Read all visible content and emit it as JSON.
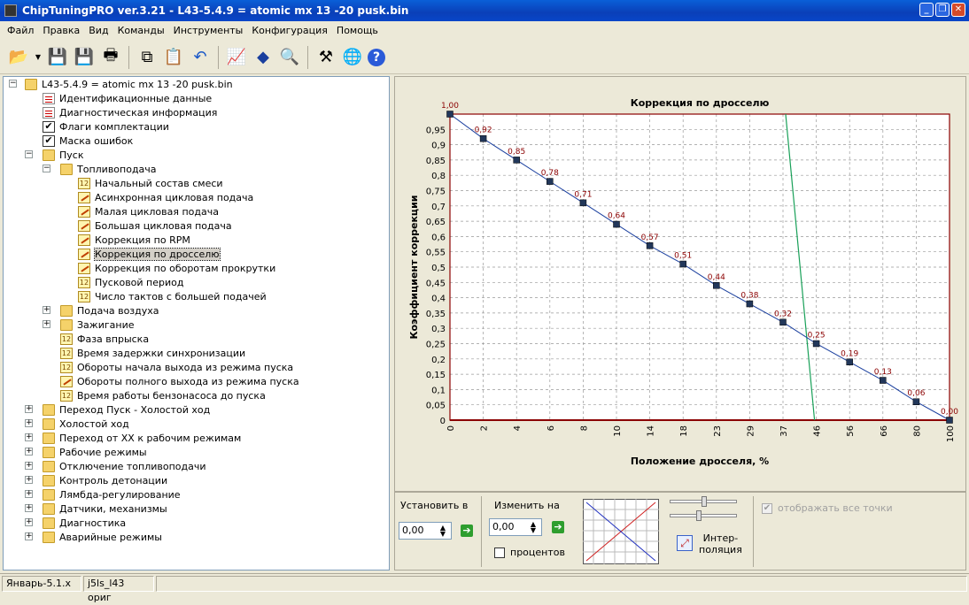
{
  "window": {
    "title": "ChipTuningPRO ver.3.21 - L43-5.4.9 = atomic mx 13 -20 pusk.bin"
  },
  "menu": [
    "Файл",
    "Правка",
    "Вид",
    "Команды",
    "Инструменты",
    "Конфигурация",
    "Помощь"
  ],
  "toolbar": {
    "icons": [
      "open-icon",
      "dropdown-arrow-icon",
      "save-icon",
      "save-as-icon",
      "print-icon",
      "copy-icon",
      "paste-icon",
      "undo-icon",
      "chart-icon",
      "info-icon",
      "zoom-icon",
      "tools-icon",
      "network-icon",
      "help-icon"
    ]
  },
  "tree": {
    "root": "L43-5.4.9 = atomic mx 13 -20 pusk.bin",
    "items": [
      {
        "label": "Идентификационные данные",
        "icon": "doc"
      },
      {
        "label": "Диагностическая информация",
        "icon": "doc"
      },
      {
        "label": "Флаги комплектации",
        "icon": "chk"
      },
      {
        "label": "Маска ошибок",
        "icon": "chk"
      },
      {
        "label": "Пуск",
        "icon": "folder"
      },
      {
        "label": "Топливоподача",
        "icon": "folder"
      },
      {
        "label": "Начальный состав смеси",
        "icon": "num"
      },
      {
        "label": "Асинхронная цикловая подача",
        "icon": "gr"
      },
      {
        "label": "Малая цикловая подача",
        "icon": "gr"
      },
      {
        "label": "Большая цикловая подача",
        "icon": "gr"
      },
      {
        "label": "Коррекция по RPM",
        "icon": "gr"
      },
      {
        "label": "Коррекция по дросселю",
        "icon": "gr"
      },
      {
        "label": "Коррекция по оборотам прокрутки",
        "icon": "gr"
      },
      {
        "label": "Пусковой период",
        "icon": "num"
      },
      {
        "label": "Число тактов с большей подачей",
        "icon": "num"
      },
      {
        "label": "Подача воздуха",
        "icon": "folder"
      },
      {
        "label": "Зажигание",
        "icon": "folder"
      },
      {
        "label": "Фаза впрыска",
        "icon": "num"
      },
      {
        "label": "Время задержки синхронизации",
        "icon": "num"
      },
      {
        "label": "Обороты начала выхода из режима пуска",
        "icon": "num"
      },
      {
        "label": "Обороты полного выхода из режима пуска",
        "icon": "gr"
      },
      {
        "label": "Время работы бензонасоса до пуска",
        "icon": "num"
      },
      {
        "label": "Переход Пуск - Холостой ход",
        "icon": "folder"
      },
      {
        "label": "Холостой ход",
        "icon": "folder"
      },
      {
        "label": "Переход от ХХ к рабочим режимам",
        "icon": "folder"
      },
      {
        "label": "Рабочие режимы",
        "icon": "folder"
      },
      {
        "label": "Отключение топливоподачи",
        "icon": "folder"
      },
      {
        "label": "Контроль детонации",
        "icon": "folder"
      },
      {
        "label": "Лямбда-регулирование",
        "icon": "folder"
      },
      {
        "label": "Датчики, механизмы",
        "icon": "folder"
      },
      {
        "label": "Диагностика",
        "icon": "folder"
      },
      {
        "label": "Аварийные режимы",
        "icon": "folder"
      }
    ]
  },
  "chart_data": {
    "type": "line",
    "title": "Коррекция по дросселю",
    "xlabel": "Положение дросселя, %",
    "ylabel": "Коэффициент коррекции",
    "x": [
      "0",
      "2",
      "4",
      "6",
      "8",
      "10",
      "14",
      "18",
      "23",
      "29",
      "37",
      "46",
      "56",
      "66",
      "80",
      "100"
    ],
    "values": [
      1.0,
      0.92,
      0.85,
      0.78,
      0.71,
      0.64,
      0.57,
      0.51,
      0.44,
      0.38,
      0.32,
      0.25,
      0.19,
      0.13,
      0.06,
      0.0
    ],
    "labels": [
      "1,00",
      "0,92",
      "0,85",
      "0,78",
      "0,71",
      "0,64",
      "0,57",
      "0,51",
      "0,44",
      "0,38",
      "0,32",
      "0,25",
      "0,19",
      "0,13",
      "0,06",
      "0,00"
    ],
    "yticks": [
      "0",
      "0,05",
      "0,1",
      "0,15",
      "0,2",
      "0,25",
      "0,3",
      "0,35",
      "0,4",
      "0,45",
      "0,5",
      "0,55",
      "0,6",
      "0,65",
      "0,7",
      "0,75",
      "0,8",
      "0,85",
      "0,9",
      "0,95"
    ],
    "ylim": [
      0,
      1
    ],
    "grid": true,
    "series_color": "#1a3f9e",
    "marker_color": "#22375a",
    "label_color": "#8b0000",
    "frame_color": "#8b0000",
    "cursor_color": "#18a058"
  },
  "panel": {
    "set_label": "Установить в",
    "set_value": "0,00",
    "change_label": "Изменить на",
    "change_value": "0,00",
    "percent_label": "процентов",
    "interp_label": "Интер-\nполяция",
    "show_all_label": "отображать все точки"
  },
  "status": {
    "left": "Январь-5.1.x",
    "mid": "j5ls_l43 ориг"
  }
}
